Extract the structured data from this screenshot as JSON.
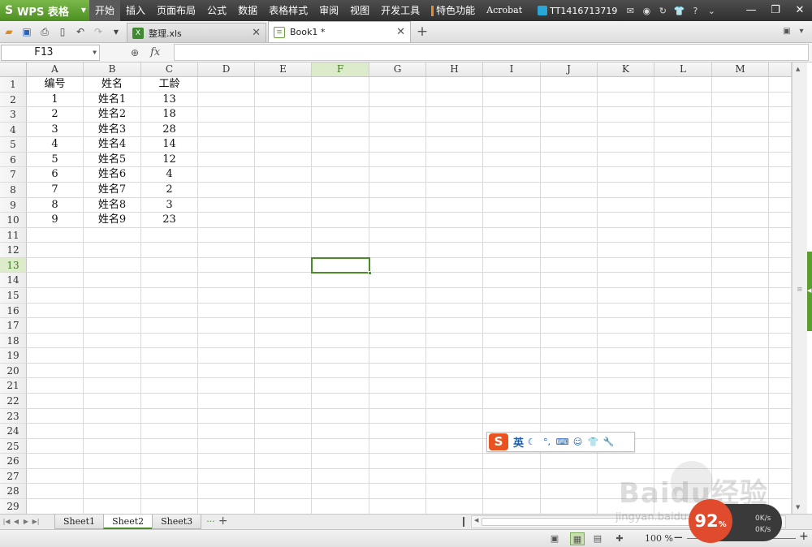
{
  "app": {
    "name": "WPS 表格",
    "logo_glyph": "S"
  },
  "menu": {
    "items": [
      "开始",
      "插入",
      "页面布局",
      "公式",
      "数据",
      "表格样式",
      "审阅",
      "视图",
      "开发工具"
    ],
    "special": "特色功能",
    "acrobat": "Acrobat",
    "user_id": "TT1416713719",
    "help": "?"
  },
  "tabs": [
    {
      "label": "整理.xls",
      "icon": "xls-file-icon"
    },
    {
      "label": "Book1 *",
      "icon": "workbook-icon"
    }
  ],
  "formula": {
    "cell_ref": "F13",
    "fx_label": "fx",
    "value": ""
  },
  "grid": {
    "columns": [
      "A",
      "B",
      "C",
      "D",
      "E",
      "F",
      "G",
      "H",
      "I",
      "J",
      "K",
      "L",
      "M"
    ],
    "selected_column": "F",
    "selected_row": 13,
    "active_cell": "F13",
    "row_count": 29,
    "rows": [
      [
        "编号",
        "姓名",
        "工龄"
      ],
      [
        "1",
        "姓名1",
        "13"
      ],
      [
        "2",
        "姓名2",
        "18"
      ],
      [
        "3",
        "姓名3",
        "28"
      ],
      [
        "4",
        "姓名4",
        "14"
      ],
      [
        "5",
        "姓名5",
        "12"
      ],
      [
        "6",
        "姓名6",
        "4"
      ],
      [
        "7",
        "姓名7",
        "2"
      ],
      [
        "8",
        "姓名8",
        "3"
      ],
      [
        "9",
        "姓名9",
        "23"
      ]
    ]
  },
  "sheets": {
    "tabs": [
      "Sheet1",
      "Sheet2",
      "Sheet3"
    ],
    "active": "Sheet2",
    "more": "···",
    "add": "+"
  },
  "status": {
    "zoom": "100 %"
  },
  "ime": {
    "mode": "英"
  },
  "overlay": {
    "watermark": "Baidu经验",
    "watermark_url": "jingyan.baidu.com",
    "net_percent": "92",
    "net_up": "0K/s",
    "net_down": "0K/s"
  },
  "colors": {
    "accent": "#4a8c28",
    "selected_header_bg": "#dcebc9",
    "logo_bg": "#5a9e2f",
    "ime_logo": "#e8531f"
  }
}
